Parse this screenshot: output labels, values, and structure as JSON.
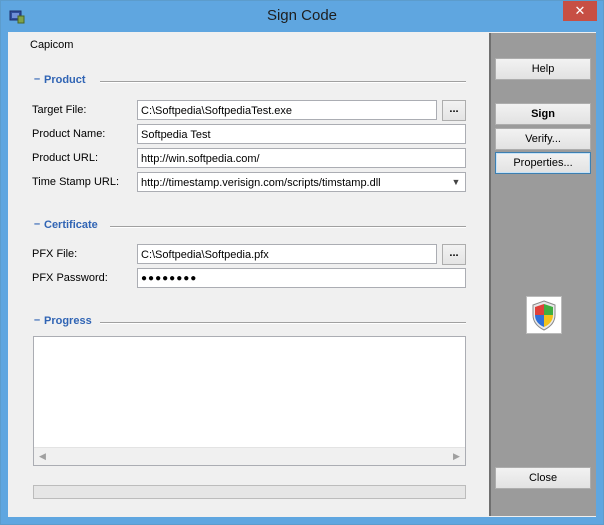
{
  "window": {
    "title": "Sign Code",
    "close_glyph": "✕"
  },
  "header": {
    "app_name": "Capicom"
  },
  "product": {
    "section_label": "Product",
    "target_file": {
      "label": "Target File:",
      "value": "C:\\Softpedia\\SoftpediaTest.exe"
    },
    "product_name": {
      "label": "Product Name:",
      "value": "Softpedia Test"
    },
    "product_url": {
      "label": "Product URL:",
      "value": "http://win.softpedia.com/"
    },
    "timestamp_url": {
      "label": "Time Stamp URL:",
      "value": "http://timestamp.verisign.com/scripts/timstamp.dll"
    }
  },
  "certificate": {
    "section_label": "Certificate",
    "pfx_file": {
      "label": "PFX File:",
      "value": "C:\\Softpedia\\Softpedia.pfx"
    },
    "pfx_password": {
      "label": "PFX Password:",
      "value": "●●●●●●●●"
    }
  },
  "progress": {
    "section_label": "Progress",
    "percent": 0
  },
  "browse_label": "...",
  "sidebar": {
    "help": "Help",
    "sign": "Sign",
    "verify": "Verify...",
    "properties": "Properties...",
    "close": "Close"
  },
  "icons": {
    "app": "certificate-app-icon",
    "shield": "security-shield-icon",
    "dropdown": "chevron-down-icon"
  }
}
